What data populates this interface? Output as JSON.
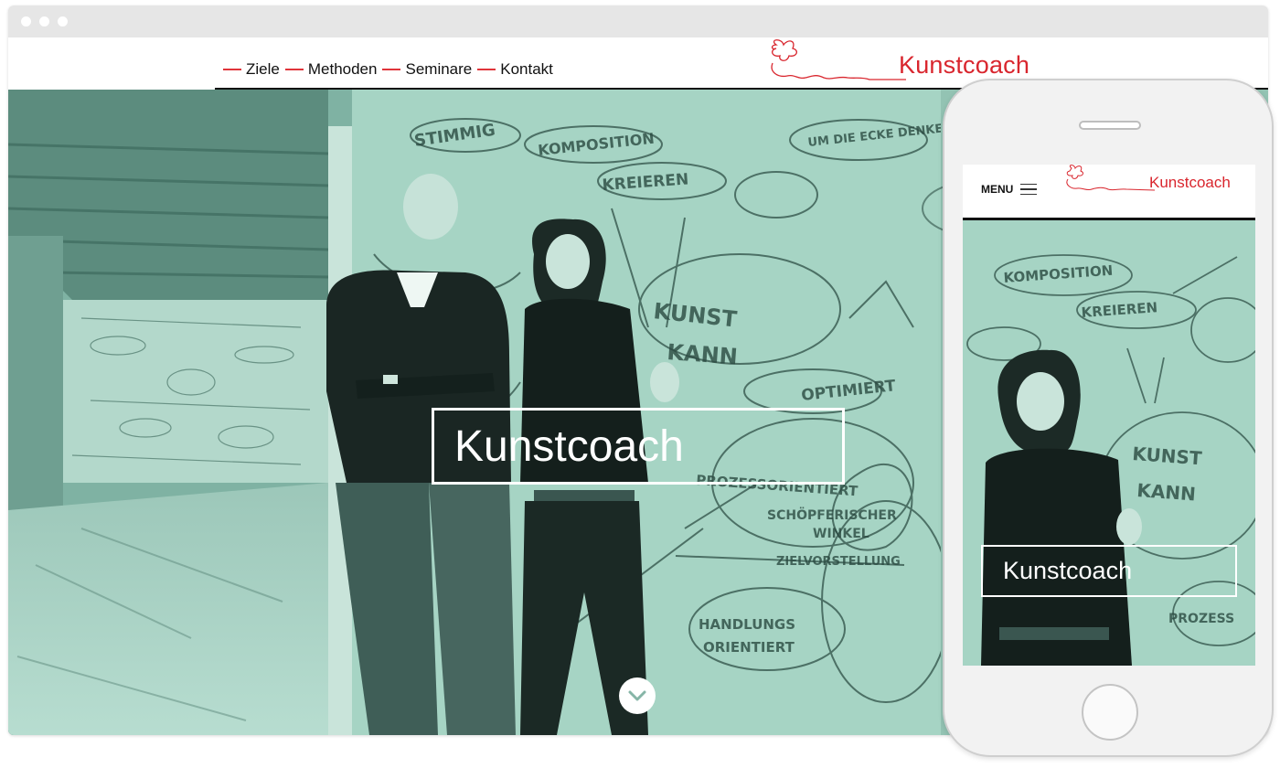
{
  "desktop": {
    "nav": [
      {
        "label": "Ziele"
      },
      {
        "label": "Methoden"
      },
      {
        "label": "Seminare"
      },
      {
        "label": "Kontakt"
      }
    ],
    "logo_text": "Kunstcoach",
    "hero_title": "Kunstcoach",
    "scroll_icon": "chevron-down-icon"
  },
  "mobile": {
    "menu_label": "MENU",
    "logo_text": "Kunstcoach",
    "hero_title": "Kunstcoach"
  },
  "colors": {
    "brand_red": "#d9262e",
    "hero_tint": "#86b5a7",
    "chrome_gray": "#e6e6e6"
  }
}
